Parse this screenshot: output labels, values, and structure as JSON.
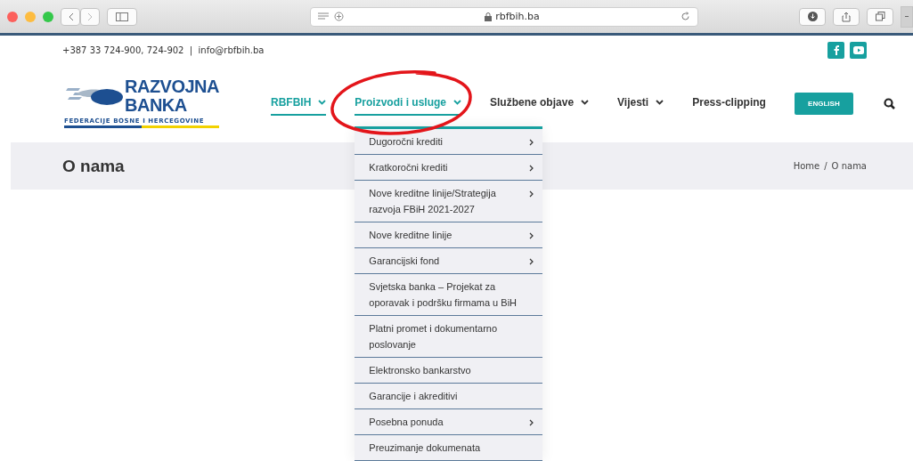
{
  "browser": {
    "url": "rbfbih.ba"
  },
  "top_bar": {
    "phone": "+387 33 724-900, 724-902",
    "separator": "|",
    "email": "info@rbfbih.ba"
  },
  "logo": {
    "line1": "RAZVOJNA",
    "line2": "BANKA",
    "tagline": "FEDERACIJE BOSNE I HERCEGOVINE"
  },
  "nav": [
    {
      "label": "RBFBIH",
      "dropdown": true,
      "selected": true,
      "kind": "link"
    },
    {
      "label": "Proizvodi i usluge",
      "dropdown": true,
      "selected": true,
      "kind": "link",
      "circled": true
    },
    {
      "label": "Službene objave",
      "dropdown": true,
      "selected": false,
      "kind": "link"
    },
    {
      "label": "Vijesti",
      "dropdown": true,
      "selected": false,
      "kind": "link"
    },
    {
      "label": "Press-clipping",
      "dropdown": false,
      "selected": false,
      "kind": "link"
    },
    {
      "label": "ENGLISH",
      "kind": "button"
    },
    {
      "kind": "search"
    }
  ],
  "title_band": {
    "title": "O nama",
    "breadcrumb": [
      {
        "label": "Home"
      },
      {
        "label": "O nama"
      }
    ],
    "separator": "/"
  },
  "dropdown_menu": [
    {
      "label": "Dugoročni krediti",
      "submenu": true
    },
    {
      "label": "Kratkoročni krediti",
      "submenu": true
    },
    {
      "label": "Nove kreditne linije/Strategija razvoja FBiH 2021-2027",
      "submenu": true
    },
    {
      "label": "Nove kreditne linije",
      "submenu": true
    },
    {
      "label": "Garancijski fond",
      "submenu": true
    },
    {
      "label": "Svjetska banka – Projekat za oporavak i podršku firmama u BiH",
      "submenu": false
    },
    {
      "label": "Platni promet i dokumentarno poslovanje",
      "submenu": false
    },
    {
      "label": "Elektronsko bankarstvo",
      "submenu": false
    },
    {
      "label": "Garancije i akreditivi",
      "submenu": false
    },
    {
      "label": "Posebna ponuda",
      "submenu": true
    },
    {
      "label": "Preuzimanje dokumenata",
      "submenu": false
    }
  ]
}
